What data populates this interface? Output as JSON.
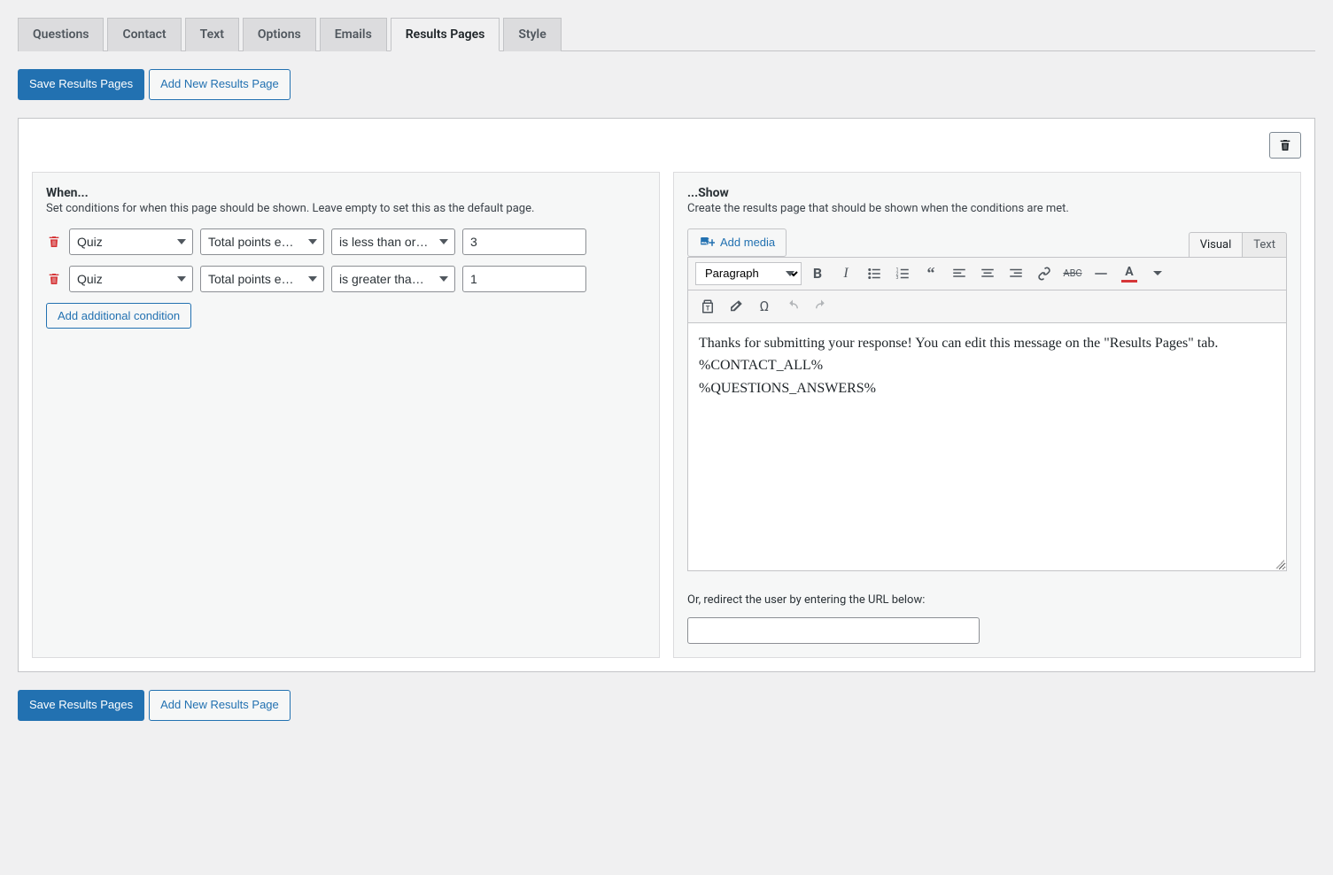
{
  "tabs": [
    "Questions",
    "Contact",
    "Text",
    "Options",
    "Emails",
    "Results Pages",
    "Style"
  ],
  "active_tab": "Results Pages",
  "buttons": {
    "save": "Save Results Pages",
    "add_new": "Add New Results Page"
  },
  "when_panel": {
    "heading": "When...",
    "sub": "Set conditions for when this page should be shown. Leave empty to set this as the default page.",
    "conditions": [
      {
        "scope": "Quiz",
        "metric": "Total points earned",
        "operator": "is less than or equal to",
        "value": "3"
      },
      {
        "scope": "Quiz",
        "metric": "Total points earned",
        "operator": "is greater than or equal to",
        "value": "1"
      }
    ],
    "add_condition": "Add additional condition"
  },
  "show_panel": {
    "heading": "...Show",
    "sub": "Create the results page that should be shown when the conditions are met.",
    "add_media": "Add media",
    "editor_tabs": {
      "visual": "Visual",
      "text": "Text"
    },
    "format_select": "Paragraph",
    "content": "Thanks for submitting your response! You can edit this message on the \"Results Pages\" tab.\n%CONTACT_ALL%\n%QUESTIONS_ANSWERS%",
    "redirect_label": "Or, redirect the user by entering the URL below:",
    "redirect_value": ""
  }
}
